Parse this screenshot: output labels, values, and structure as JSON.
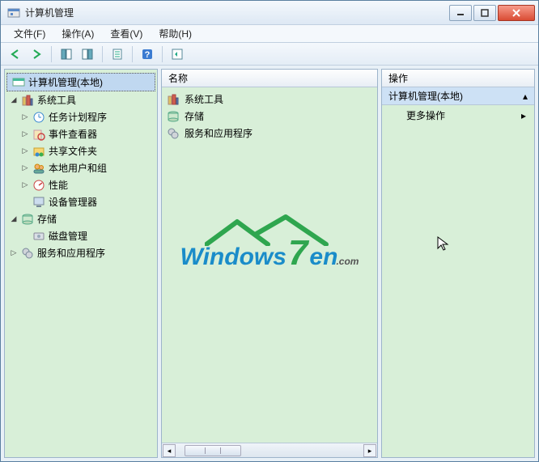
{
  "window": {
    "title": "计算机管理"
  },
  "menu": {
    "file": "文件(F)",
    "action": "操作(A)",
    "view": "查看(V)",
    "help": "帮助(H)"
  },
  "tree": {
    "root": "计算机管理(本地)",
    "systools": {
      "label": "系统工具",
      "children": {
        "tasksched": "任务计划程序",
        "eventviewer": "事件查看器",
        "sharedfold": "共享文件夹",
        "localusers": "本地用户和组",
        "performance": "性能",
        "devmgr": "设备管理器"
      }
    },
    "storage": {
      "label": "存储",
      "children": {
        "diskmgmt": "磁盘管理"
      }
    },
    "services": {
      "label": "服务和应用程序"
    }
  },
  "list": {
    "header_name": "名称",
    "rows": {
      "systools": "系统工具",
      "storage": "存储",
      "services": "服务和应用程序"
    }
  },
  "actions": {
    "header": "操作",
    "section": "计算机管理(本地)",
    "more": "更多操作"
  },
  "watermark": {
    "text1": "Windows",
    "big": "7",
    "text2": "en",
    "suffix": ".com"
  }
}
